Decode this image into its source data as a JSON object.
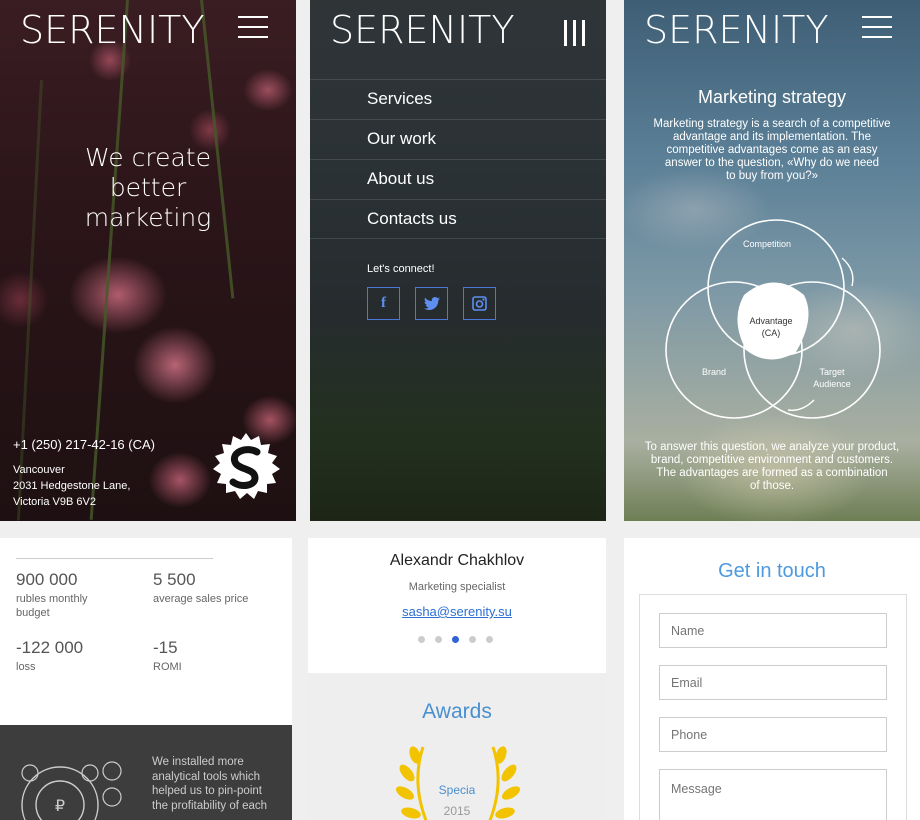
{
  "brand": "SERENITY",
  "home": {
    "headline": [
      "We create",
      "better",
      "marketing"
    ],
    "phone": "+1 (250) 217-42-16 (CA)",
    "address": [
      "Vancouver",
      "2031 Hedgestone Lane,",
      "Victoria V9B 6V2"
    ]
  },
  "menu": {
    "items": [
      "Services",
      "Our work",
      "About us",
      "Contacts us"
    ],
    "connect_label": "Let's connect!",
    "socials": [
      "facebook-icon",
      "twitter-icon",
      "instagram-icon"
    ]
  },
  "strategy": {
    "title": "Marketing strategy",
    "intro": [
      "Marketing strategy is a search of a competitive",
      "advantage and its implementation. The",
      "competitive advantages come as an easy",
      "answer to the question, «Why do we need",
      "to buy from you?»"
    ],
    "venn": {
      "competition": "Competition",
      "advantage": [
        "Advantage",
        "(CA)"
      ],
      "brand": "Brand",
      "target": [
        "Target",
        "Audience"
      ]
    },
    "outro": [
      "To answer this question, we analyze your product,",
      "brand, competitive environment and customers.",
      "The advantages are formed as a combination",
      "of those."
    ]
  },
  "stats": {
    "items": [
      {
        "num": "900 000",
        "label": [
          "rubles monthly",
          "budget"
        ]
      },
      {
        "num": "5 500",
        "label": [
          "average sales price"
        ]
      },
      {
        "num": "-122 000",
        "label": [
          "loss"
        ]
      },
      {
        "num": "-15",
        "label": [
          "ROMI"
        ]
      }
    ],
    "note": [
      "We installed more",
      "analytical tools which",
      "helped us to pin-point",
      "the profitability of each"
    ]
  },
  "team": {
    "name": "Alexandr Chakhlov",
    "role": "Marketing specialist",
    "email": "sasha@serenity.su",
    "dots": 5,
    "active_dot": 2
  },
  "awards": {
    "title": "Awards",
    "award_name": "Specia",
    "award_year": "2015"
  },
  "contact": {
    "title": "Get in touch",
    "name_ph": "Name",
    "email_ph": "Email",
    "phone_ph": "Phone",
    "message_ph": "Message"
  },
  "colors": {
    "accent": "#2f63d8",
    "link": "#2a6fd4",
    "heading_blue": "#4d9ae0",
    "gold": "#f2c300"
  }
}
